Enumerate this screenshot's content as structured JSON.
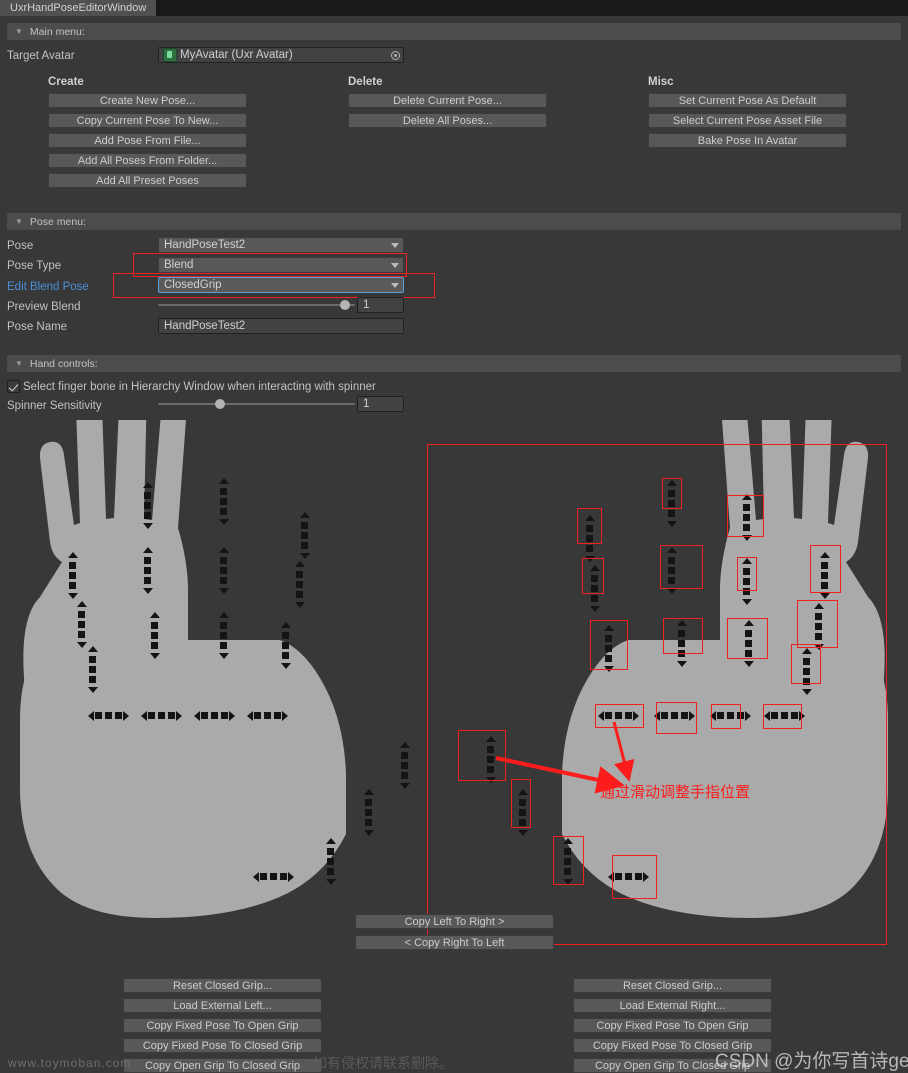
{
  "window": {
    "tab_title": "UxrHandPoseEditorWindow"
  },
  "main_menu": {
    "header": "Main menu:",
    "target_avatar_label": "Target Avatar",
    "target_avatar_value": "MyAvatar (Uxr Avatar)",
    "create": {
      "title": "Create",
      "buttons": [
        "Create New Pose...",
        "Copy Current Pose To New...",
        "Add Pose From File...",
        "Add All Poses From Folder...",
        "Add All Preset Poses"
      ]
    },
    "delete": {
      "title": "Delete",
      "buttons": [
        "Delete Current Pose...",
        "Delete All Poses..."
      ]
    },
    "misc": {
      "title": "Misc",
      "buttons": [
        "Set Current Pose As Default",
        "Select Current Pose Asset File",
        "Bake Pose In Avatar"
      ]
    }
  },
  "pose_menu": {
    "header": "Pose menu:",
    "pose_label": "Pose",
    "pose_value": "HandPoseTest2",
    "pose_type_label": "Pose Type",
    "pose_type_value": "Blend",
    "edit_blend_pose_label": "Edit Blend Pose",
    "edit_blend_pose_value": "ClosedGrip",
    "preview_blend_label": "Preview Blend",
    "preview_blend_value": "1",
    "pose_name_label": "Pose Name",
    "pose_name_value": "HandPoseTest2"
  },
  "hand_controls": {
    "header": "Hand controls:",
    "select_bone_label": "Select finger bone in Hierarchy Window when interacting with spinner",
    "select_bone_checked": true,
    "spinner_sensitivity_label": "Spinner Sensitivity",
    "spinner_sensitivity_value": "1"
  },
  "copy_buttons": {
    "left_to_right": "Copy Left To Right >",
    "right_to_left": "< Copy Right To Left"
  },
  "left_hand_buttons": [
    "Reset Closed Grip...",
    "Load External Left...",
    "Copy Fixed Pose To Open Grip",
    "Copy Fixed Pose To Closed Grip",
    "Copy Open Grip To Closed Grip"
  ],
  "right_hand_buttons": [
    "Reset Closed Grip...",
    "Load External Right...",
    "Copy Fixed Pose To Open Grip",
    "Copy Fixed Pose To Closed Grip",
    "Copy Open Grip To Closed Grip"
  ],
  "annotations": {
    "note_text": "通过滑动调整手指位置",
    "accent_color": "#ef2020"
  },
  "watermarks": {
    "left": "www.toymoban.com",
    "middle": "如有侵权请联系删除。",
    "csdn": "CSDN @为你写首诗ge"
  },
  "colors": {
    "window_bg": "#383838",
    "panel_header": "#4c4c4c",
    "button": "#585858",
    "field": "#424242",
    "hand_fill": "#aaaaaa",
    "link": "#4a90d9",
    "selection": "#58a0e0"
  }
}
